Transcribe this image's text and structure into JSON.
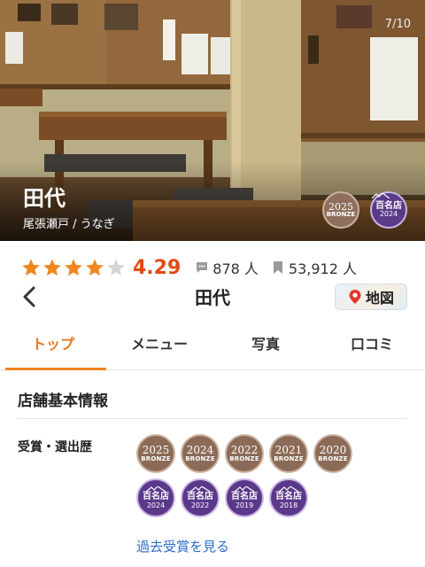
{
  "photo": {
    "counter": "7/10",
    "shop_name": "田代",
    "area": "尾張瀬戸 / うなぎ",
    "badges": [
      {
        "year": "2025",
        "sub": "BRONZE"
      },
      {
        "title": "百名店",
        "year": "2024"
      }
    ]
  },
  "rating": {
    "stars_filled": 4,
    "stars_total": 5,
    "score": "4.29",
    "reviews": "878 人",
    "bookmarks": "53,912 人",
    "star_color": "#f0861f",
    "score_color": "#e24a12"
  },
  "nav": {
    "title": "田代",
    "map_label": "地図"
  },
  "tabs": [
    "トップ",
    "メニュー",
    "写真",
    "口コミ"
  ],
  "info": {
    "section_title": "店舗基本情報",
    "awards_label": "受賞・選出歴",
    "bronze_badges": [
      {
        "year": "2025",
        "sub": "BRONZE"
      },
      {
        "year": "2024",
        "sub": "BRONZE"
      },
      {
        "year": "2022",
        "sub": "BRONZE"
      },
      {
        "year": "2021",
        "sub": "BRONZE"
      },
      {
        "year": "2020",
        "sub": "BRONZE"
      }
    ],
    "hyakumeiten_badges": [
      {
        "title": "百名店",
        "year": "2024"
      },
      {
        "title": "百名店",
        "year": "2022"
      },
      {
        "title": "百名店",
        "year": "2019"
      },
      {
        "title": "百名店",
        "year": "2018"
      }
    ],
    "past_awards_link": "過去受賞を見る"
  },
  "colors": {
    "accent": "#f0861f",
    "bronze": "#8b6b57",
    "hyakumeiten": "#5a388a",
    "link": "#2b6dc9"
  }
}
